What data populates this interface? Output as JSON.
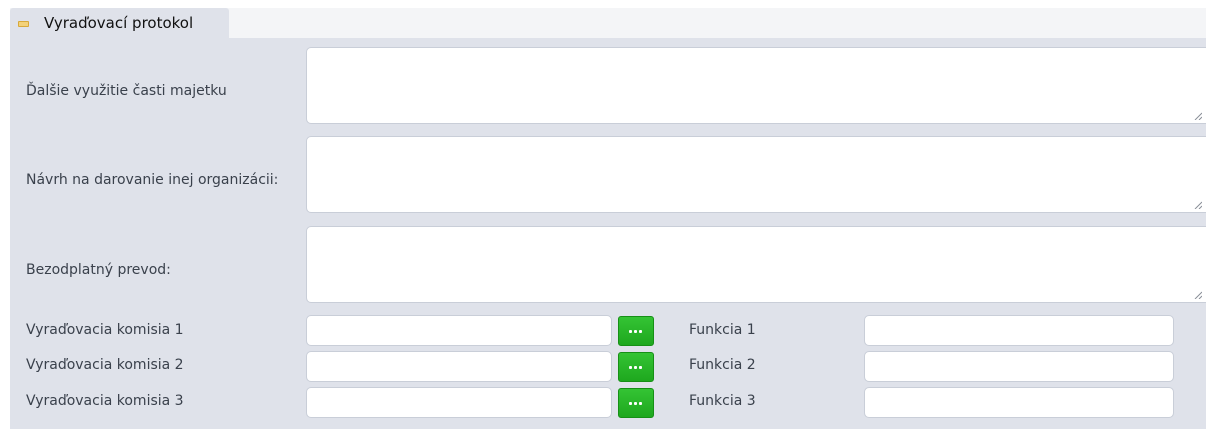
{
  "section": {
    "title": "Vyraďovací protokol",
    "collapse_icon": "minus-icon"
  },
  "fields": {
    "dalsie_vyuzitie": {
      "label": "Ďalšie využitie časti majetku",
      "value": ""
    },
    "navrh_darovanie": {
      "label": "Návrh na darovanie inej organizácii:",
      "value": ""
    },
    "bezodplatny_prevod": {
      "label": "Bezodplatný prevod:",
      "value": ""
    }
  },
  "komisia": [
    {
      "label": "Vyraďovacia komisia 1",
      "value": "",
      "button_icon": "ellipsis-icon",
      "funkcia_label": "Funkcia 1",
      "funkcia_value": ""
    },
    {
      "label": "Vyraďovacia komisia 2",
      "value": "",
      "button_icon": "ellipsis-icon",
      "funkcia_label": "Funkcia 2",
      "funkcia_value": ""
    },
    {
      "label": "Vyraďovacia komisia 3",
      "value": "",
      "button_icon": "ellipsis-icon",
      "funkcia_label": "Funkcia 3",
      "funkcia_value": ""
    }
  ],
  "colors": {
    "panel_bg": "#dfe2ea",
    "button_green": "#22b022"
  }
}
